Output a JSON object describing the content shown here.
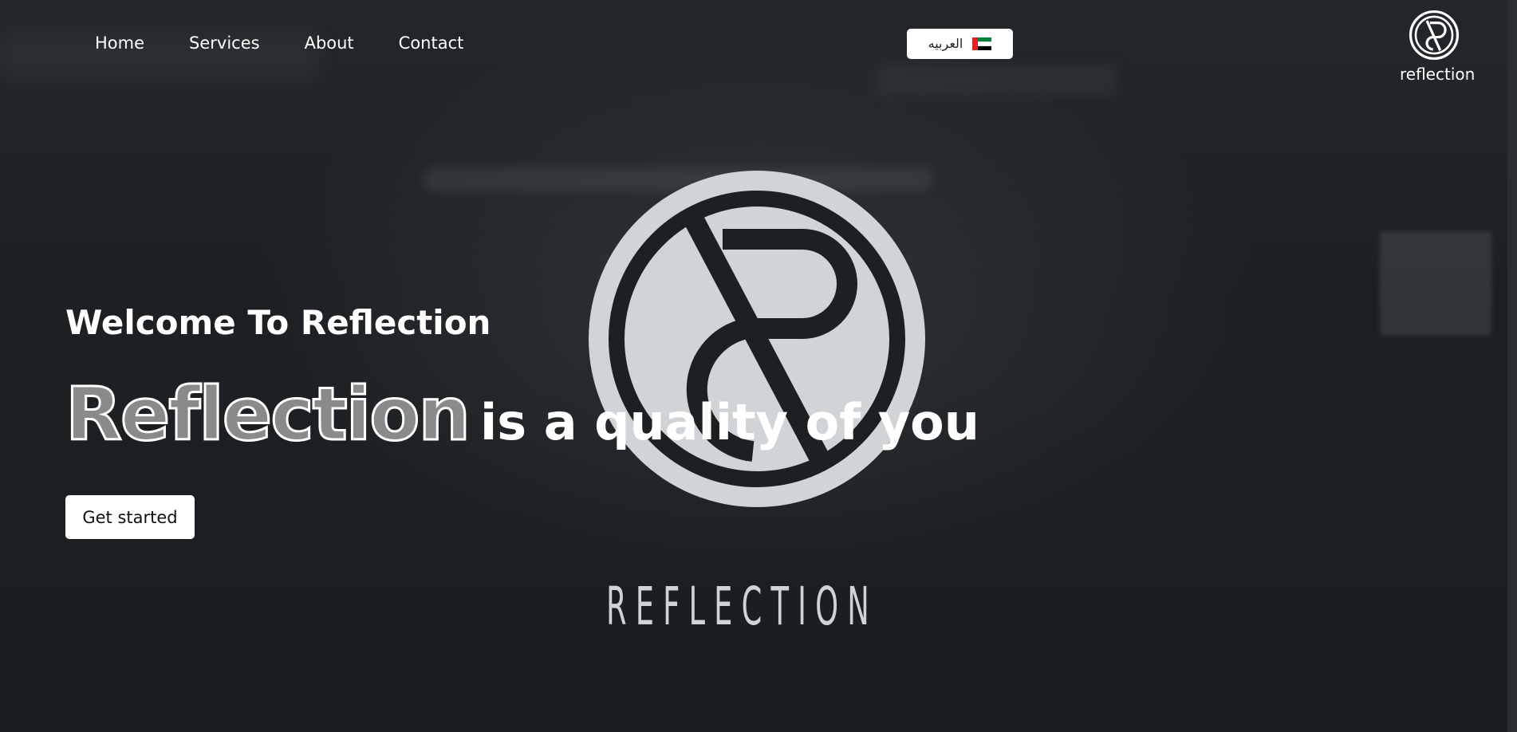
{
  "nav": {
    "items": [
      {
        "label": "Home"
      },
      {
        "label": "Services"
      },
      {
        "label": "About"
      },
      {
        "label": "Contact"
      }
    ]
  },
  "language": {
    "label": "العربيه",
    "flag": "uae-flag-icon"
  },
  "brand": {
    "logo_text": "reflection",
    "wordmark": "REFLECTION"
  },
  "hero": {
    "welcome": "Welcome To Reflection",
    "highlight": "Reflection",
    "tagline_rest": "is a quality of you",
    "cta_label": "Get started"
  },
  "colors": {
    "background": "#1b1f22",
    "logo_gray": "#d0d4d6",
    "button_bg": "#ffffff"
  }
}
